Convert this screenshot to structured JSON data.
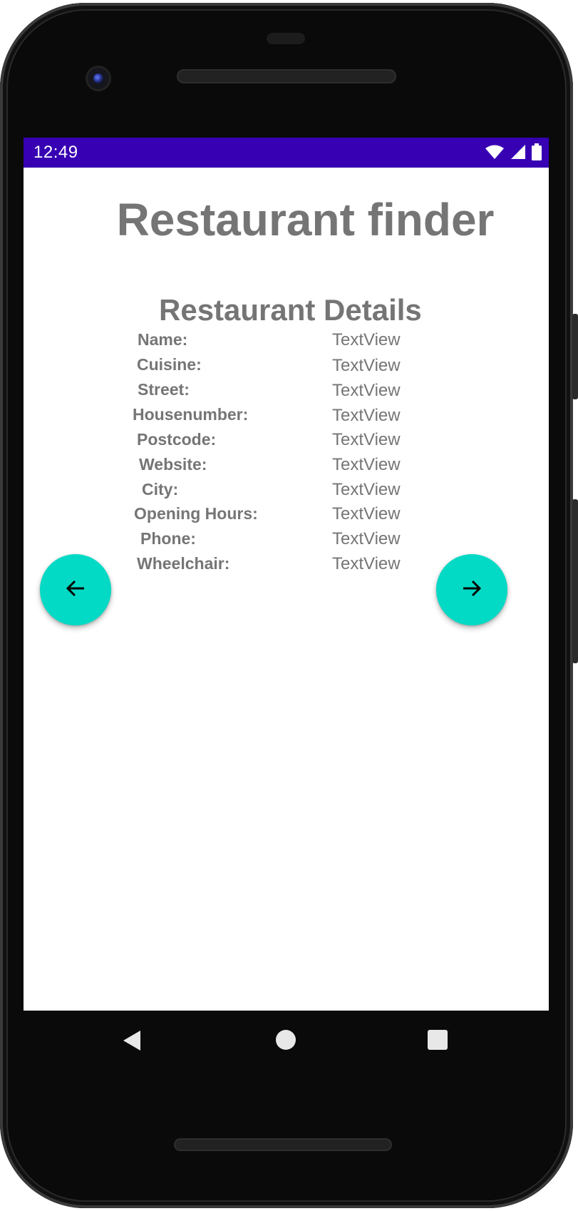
{
  "status_bar": {
    "time": "12:49",
    "background_color": "#3700b3",
    "icons": [
      "wifi-icon",
      "cellular-signal-icon",
      "battery-icon"
    ]
  },
  "app": {
    "title": "Restaurant finder",
    "section_title": "Restaurant Details"
  },
  "details": {
    "rows": [
      {
        "label": "Name:",
        "value": "TextView"
      },
      {
        "label": "Cuisine:",
        "value": "TextView"
      },
      {
        "label": "Street:",
        "value": "TextView"
      },
      {
        "label": "Housenumber:",
        "value": "TextView"
      },
      {
        "label": "Postcode:",
        "value": "TextView"
      },
      {
        "label": "Website:",
        "value": "TextView"
      },
      {
        "label": "City:",
        "value": "TextView"
      },
      {
        "label": "Opening Hours:",
        "value": "TextView"
      },
      {
        "label": "Phone:",
        "value": "TextView"
      },
      {
        "label": "Wheelchair:",
        "value": "TextView"
      }
    ]
  },
  "buttons": {
    "back_icon": "arrow-back-icon",
    "next_icon": "arrow-forward-icon",
    "fab_color": "#03dac5"
  },
  "navigation_bar": {
    "icons": [
      "nav-back-icon",
      "nav-home-icon",
      "nav-recents-icon"
    ]
  }
}
